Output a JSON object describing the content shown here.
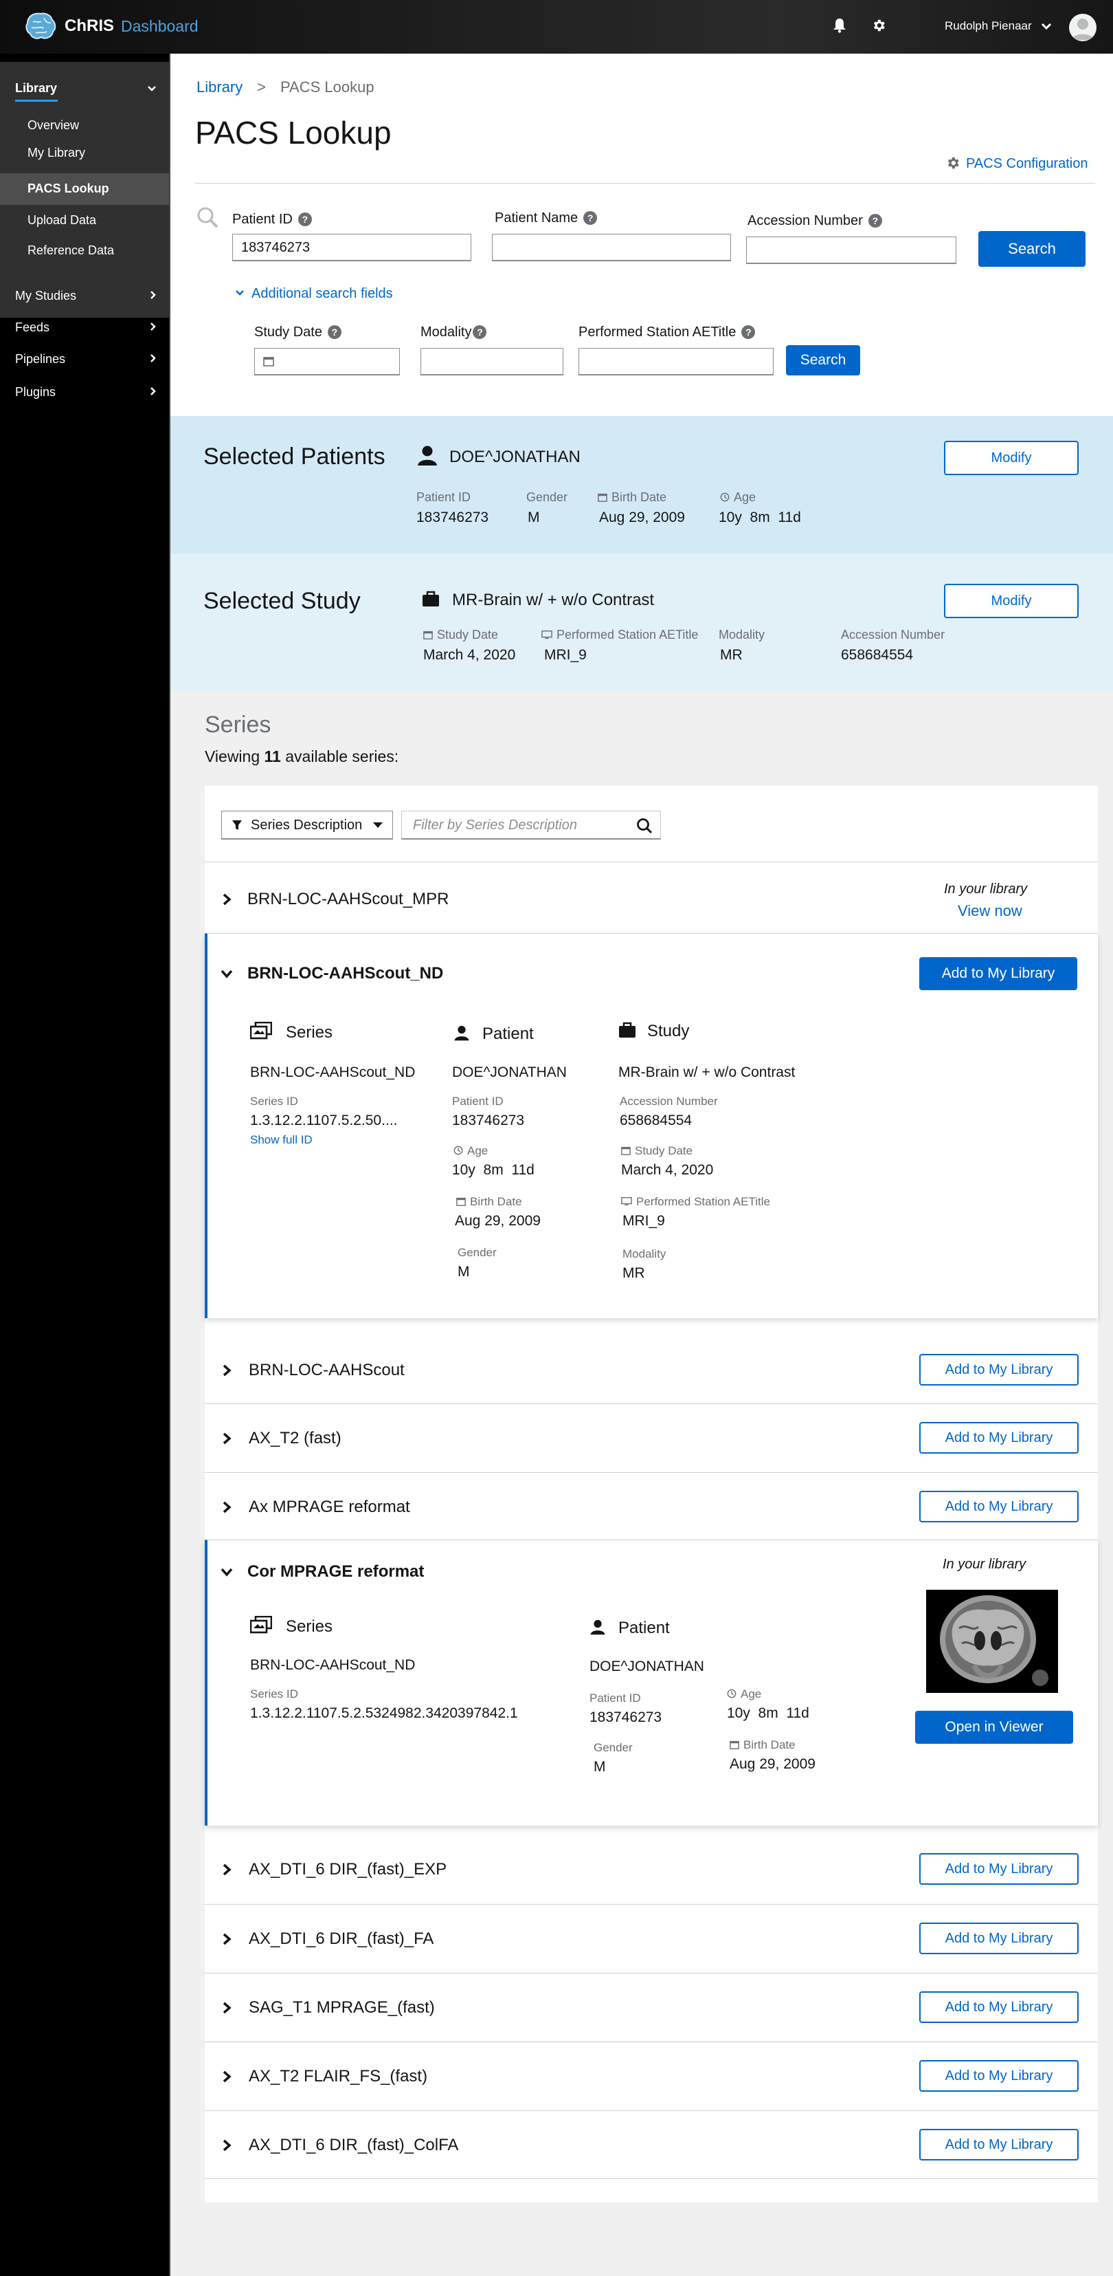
{
  "header": {
    "brand": "ChRIS",
    "brand_sub": "Dashboard",
    "user_name": "Rudolph Pienaar"
  },
  "sidebar": {
    "library": "Library",
    "library_items": [
      "Overview",
      "My Library",
      "PACS Lookup",
      "Upload Data",
      "Reference Data"
    ],
    "items": [
      "My Studies",
      "Feeds",
      "Pipelines",
      "Plugins"
    ]
  },
  "breadcrumb": {
    "root": "Library",
    "sep": ">",
    "current": "PACS Lookup"
  },
  "page_title": "PACS Lookup",
  "pacs_config": "PACS Configuration",
  "search": {
    "patient_id_label": "Patient ID",
    "patient_id_value": "183746273",
    "patient_name_label": "Patient Name",
    "accession_label": "Accession Number",
    "search_btn": "Search",
    "additional": "Additional search fields",
    "study_date_label": "Study Date",
    "modality_label": "Modality",
    "station_label": "Performed Station AETitle",
    "search_btn2": "Search"
  },
  "selected_patients": {
    "title": "Selected Patients",
    "name": "DOE^JONATHAN",
    "modify": "Modify",
    "patient_id_label": "Patient ID",
    "patient_id": "183746273",
    "gender_label": "Gender",
    "gender": "M",
    "birth_label": "Birth Date",
    "birth": "Aug 29, 2009",
    "age_label": "Age",
    "age": "10y  8m  11d"
  },
  "selected_study": {
    "title": "Selected Study",
    "name": "MR-Brain w/ + w/o Contrast",
    "modify": "Modify",
    "date_label": "Study Date",
    "date": "March 4, 2020",
    "station_label": "Performed Station AETitle",
    "station": "MRI_9",
    "modality_label": "Modality",
    "modality": "MR",
    "accession_label": "Accession Number",
    "accession": "658684554"
  },
  "series": {
    "heading": "Series",
    "viewing_pre": "Viewing",
    "viewing_count": "11",
    "viewing_post": "available series:",
    "filter_label": "Series Description",
    "filter_placeholder": "Filter by Series Description",
    "add_label": "Add to My Library",
    "in_library": "In your library",
    "view_now": "View now",
    "open_viewer": "Open in Viewer",
    "rows": [
      "BRN-LOC-AAHScout_MPR",
      "BRN-LOC-AAHScout_ND",
      "BRN-LOC-AAHScout",
      "AX_T2 (fast)",
      "Ax MPRAGE reformat",
      "Cor MPRAGE reformat",
      "AX_DTI_6 DIR_(fast)_EXP",
      "AX_DTI_6 DIR_(fast)_FA",
      "SAG_T1 MPRAGE_(fast)",
      "AX_T2 FLAIR_FS_(fast)",
      "AX_DTI_6 DIR_(fast)_ColFA"
    ],
    "detail1": {
      "series_h": "Series",
      "patient_h": "Patient",
      "study_h": "Study",
      "series_name": "BRN-LOC-AAHScout_ND",
      "series_id_label": "Series ID",
      "series_id": "1.3.12.2.1107.5.2.50....",
      "show_full": "Show full ID",
      "patient_name": "DOE^JONATHAN",
      "patient_id_label": "Patient ID",
      "patient_id": "183746273",
      "age_label": "Age",
      "age": "10y  8m  11d",
      "birth_label": "Birth Date",
      "birth": "Aug 29, 2009",
      "gender_label": "Gender",
      "gender": "M",
      "study_name": "MR-Brain w/ + w/o Contrast",
      "accession_label": "Accession Number",
      "accession": "658684554",
      "date_label": "Study Date",
      "date": "March 4, 2020",
      "station_label": "Performed Station AETitle",
      "station": "MRI_9",
      "modality_label": "Modality",
      "modality": "MR"
    },
    "detail2": {
      "series_h": "Series",
      "patient_h": "Patient",
      "series_name": "BRN-LOC-AAHScout_ND",
      "series_id_label": "Series ID",
      "series_id": "1.3.12.2.1107.5.2.5324982.3420397842.1",
      "patient_name": "DOE^JONATHAN",
      "patient_id_label": "Patient ID",
      "patient_id": "183746273",
      "age_label": "Age",
      "age": "10y  8m  11d",
      "gender_label": "Gender",
      "gender": "M",
      "birth_label": "Birth Date",
      "birth": "Aug 29, 2009"
    }
  },
  "colors": {
    "primary": "#0066cc",
    "sel_patients_bg": "#d4e9f6",
    "sel_study_bg": "#e2f0f7"
  }
}
